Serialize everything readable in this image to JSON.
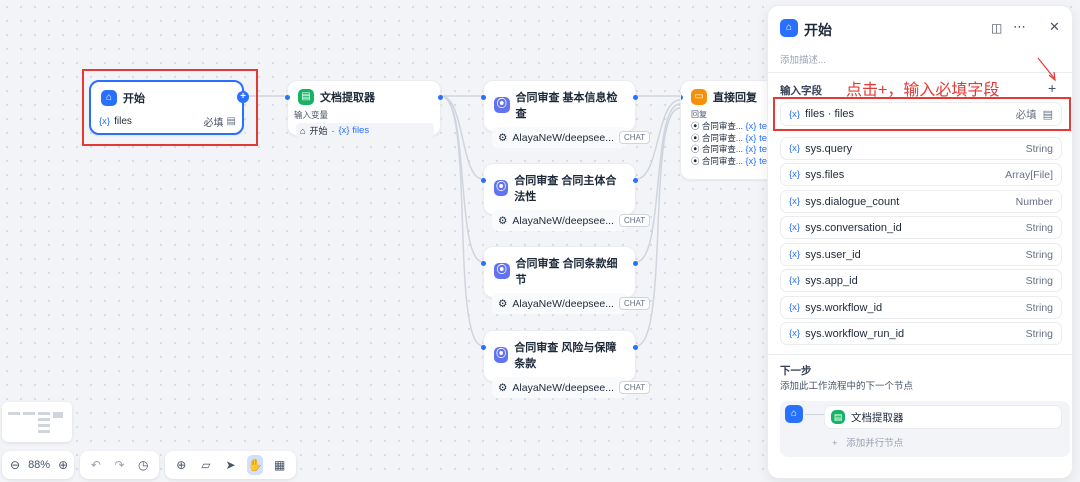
{
  "canvas": {
    "start_node": {
      "title": "开始",
      "var_label": "files",
      "var_prefix": "{x}",
      "required": "必填"
    },
    "doc_node": {
      "title": "文档提取器",
      "input_label": "输入变量",
      "input_source": "开始",
      "input_sep": "·",
      "input_var": "{x} files"
    },
    "review_nodes": [
      {
        "title": "合同审查 基本信息检查",
        "model": "AlayaNeW/deepsee...",
        "tag": "CHAT"
      },
      {
        "title": "合同审查 合同主体合法性",
        "model": "AlayaNeW/deepsee...",
        "tag": "CHAT"
      },
      {
        "title": "合同审查 合同条款细节",
        "model": "AlayaNeW/deepsee...",
        "tag": "CHAT"
      },
      {
        "title": "合同审查 风险与保障条款",
        "model": "AlayaNeW/deepsee...",
        "tag": "CHAT"
      }
    ],
    "reply_node": {
      "title": "直接回复",
      "reply_label": "回复",
      "rows": [
        {
          "source": "合同审查...",
          "var": "{x} te"
        },
        {
          "source": "合同审查...",
          "var": "{x} te"
        },
        {
          "source": "合同审查...",
          "var": "{x} te"
        },
        {
          "source": "合同审查...",
          "var": "{x} te"
        }
      ]
    }
  },
  "toolbar": {
    "zoom": "88%"
  },
  "panel": {
    "title": "开始",
    "description_placeholder": "添加描述...",
    "input_fields_label": "输入字段",
    "annotation": "点击+，输入必填字段",
    "add_symbol": "+",
    "required_field": {
      "name": "files · files",
      "required": "必填"
    },
    "fields": [
      {
        "name": "sys.query",
        "type": "String"
      },
      {
        "name": "sys.files",
        "type": "Array[File]"
      },
      {
        "name": "sys.dialogue_count",
        "type": "Number"
      },
      {
        "name": "sys.conversation_id",
        "type": "String"
      },
      {
        "name": "sys.user_id",
        "type": "String"
      },
      {
        "name": "sys.app_id",
        "type": "String"
      },
      {
        "name": "sys.workflow_id",
        "type": "String"
      },
      {
        "name": "sys.workflow_run_id",
        "type": "String"
      }
    ],
    "var_prefix": "{x}",
    "next_step_title": "下一步",
    "next_step_desc": "添加此工作流程中的下一个节点",
    "next_node": "文档提取器",
    "add_parallel": "添加并行节点"
  },
  "colors": {
    "accent": "#2970ff",
    "annotation_red": "#e53935"
  }
}
